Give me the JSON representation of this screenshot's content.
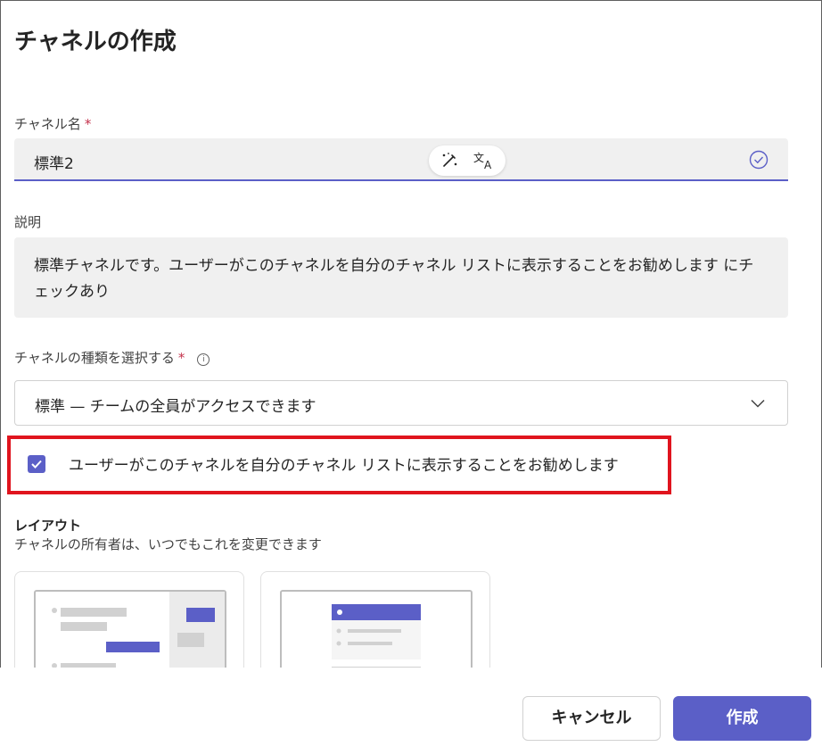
{
  "dialog": {
    "title": "チャネルの作成"
  },
  "channel_name": {
    "label": "チャネル名",
    "required_mark": "*",
    "value": "標準2"
  },
  "description": {
    "label": "説明",
    "value": "標準チャネルです。ユーザーがこのチャネルを自分のチャネル リストに表示することをお勧めします にチェックあり"
  },
  "channel_type": {
    "label": "チャネルの種類を選択する",
    "required_mark": "*",
    "info_glyph": "i",
    "selected": "標準 — チームの全員がアクセスできます"
  },
  "recommend_checkbox": {
    "checked": true,
    "label": "ユーザーがこのチャネルを自分のチャネル リストに表示することをお勧めします"
  },
  "layout": {
    "title": "レイアウト",
    "subtitle": "チャネルの所有者は、いつでもこれを変更できます",
    "options": [
      "posts-layout",
      "threads-layout"
    ]
  },
  "buttons": {
    "cancel": "キャンセル",
    "create": "作成"
  },
  "colors": {
    "accent": "#5b5fc7",
    "highlight": "#e0141e",
    "field_bg": "#f0f0f0",
    "required": "#c4314b"
  }
}
